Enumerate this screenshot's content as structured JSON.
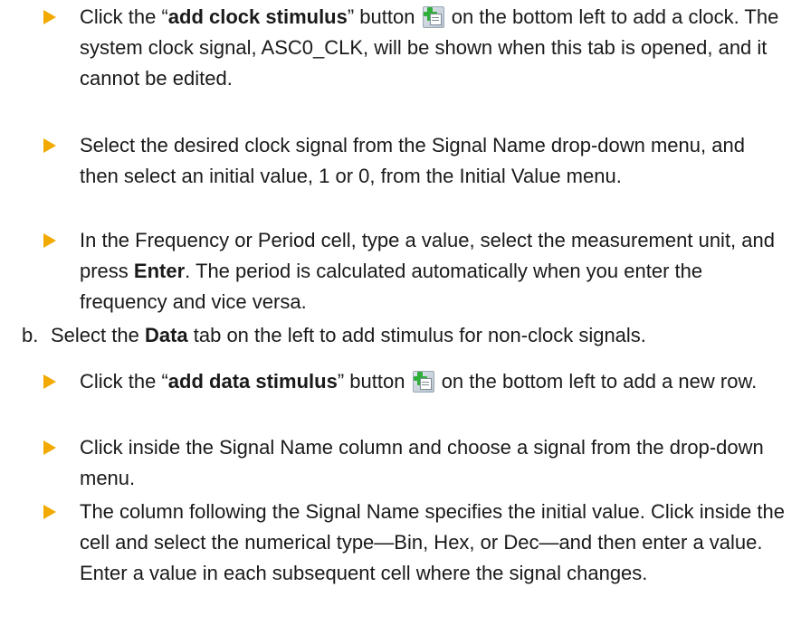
{
  "bullets_clock": [
    {
      "pre": "Click the “",
      "bold": "add clock stimulus",
      "mid": "” button",
      "post": " on the bottom left to add a clock. The system clock signal, ASC0_CLK, will be shown when this tab is opened, and it cannot be edited.",
      "icon": "add-stimulus-icon"
    },
    {
      "text": "Select the desired clock signal from the Signal Name drop-down menu, and then select an initial value, 1 or 0, from the Initial Value menu."
    },
    {
      "pre": "In the Frequency or Period cell, type a value, select the measurement unit, and press ",
      "bold": "Enter",
      "post": ". The period is calculated automatically when you enter the frequency and vice versa."
    }
  ],
  "step_b": {
    "num": "b.",
    "pre": "Select the ",
    "bold": "Data",
    "post": " tab on the left to add stimulus for non-clock signals."
  },
  "bullets_data": [
    {
      "pre": "Click the “",
      "bold": "add data stimulus",
      "mid": "” button",
      "post": " on the bottom left to add a new row.",
      "icon": "add-stimulus-icon"
    },
    {
      "text": "Click inside the Signal Name column and choose a signal from the drop-down menu."
    },
    {
      "text": "The column following the Signal Name specifies the initial value. Click inside the cell and select the numerical type—Bin, Hex, or Dec—and then enter a value. Enter a value in each subsequent cell where the signal changes."
    }
  ],
  "colors": {
    "bullet_arrow": "#f2a900",
    "icon_plus": "#2fae3a",
    "text": "#1a1a1a"
  }
}
